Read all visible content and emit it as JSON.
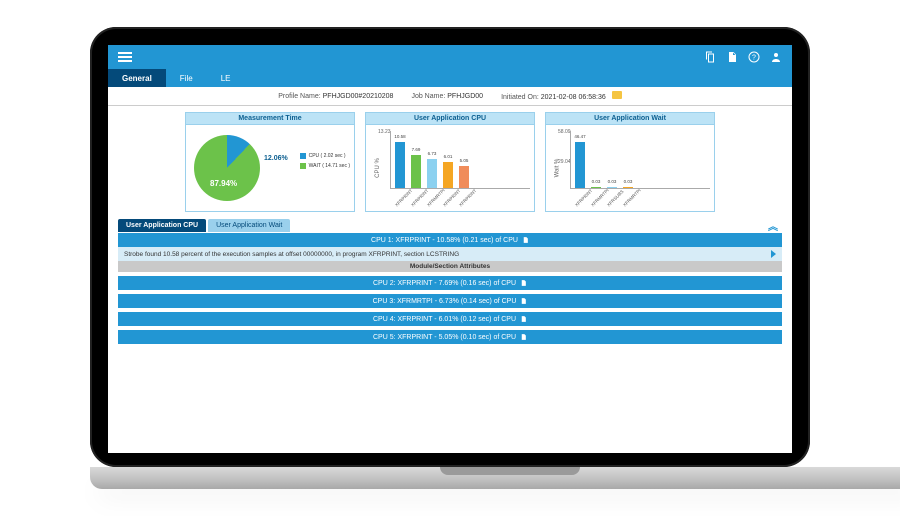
{
  "tabs": {
    "general": "General",
    "file": "File",
    "le": "LE"
  },
  "meta": {
    "profile_lbl": "Profile Name:",
    "profile_val": "PFHJGD00#20210208",
    "job_lbl": "Job Name:",
    "job_val": "PFHJGD00",
    "init_lbl": "Initiated On:",
    "init_val": "2021-02-08 06:58:36"
  },
  "cards": {
    "measurement_title": "Measurement Time",
    "app_cpu_title": "User Application CPU",
    "app_wait_title": "User Application Wait",
    "pie_pct_cpu": "12.06%",
    "pie_pct_wait": "87.94%",
    "legend_cpu": "CPU ( 2.02 sec )",
    "legend_wait": "WAIT ( 14.71 sec )",
    "cpu_ylabel": "CPU %",
    "wait_ylabel": "Wait %",
    "cpu_ytick_top": "13.23",
    "wait_ytick_top": "58.09",
    "wait_ytick_mid": "29.04"
  },
  "result_tabs": {
    "cpu": "User Application CPU",
    "wait": "User Application Wait"
  },
  "rows": {
    "r1": "CPU 1: XFRPRINT - 10.58% (0.21 sec) of CPU",
    "r1_detail": "Strobe found 10.58 percent of the execution samples at offset 00000000, in program XFRPRINT, section LCSTRING",
    "r1_attr": "Module/Section Attributes",
    "r2": "CPU 2: XFRPRINT - 7.69% (0.16 sec) of CPU",
    "r3": "CPU 3: XFRMRTPI - 6.73% (0.14 sec) of CPU",
    "r4": "CPU 4: XFRPRINT - 6.01% (0.12 sec) of CPU",
    "r5": "CPU 5: XFRPRINT - 5.05% (0.10 sec) of CPU"
  },
  "chart_data": [
    {
      "type": "pie",
      "title": "Measurement Time",
      "series": [
        {
          "name": "CPU",
          "value": 12.06,
          "seconds": 2.02,
          "color": "#2296d3"
        },
        {
          "name": "WAIT",
          "value": 87.94,
          "seconds": 14.71,
          "color": "#6cc24a"
        }
      ]
    },
    {
      "type": "bar",
      "title": "User Application CPU",
      "ylabel": "CPU %",
      "ylim": [
        0,
        13.23
      ],
      "categories": [
        "XFRPRINT",
        "XFRPRINT",
        "XFRMRTPI",
        "XFRPRINT",
        "XFRPRINT"
      ],
      "values": [
        10.58,
        7.69,
        6.73,
        6.01,
        5.05
      ],
      "colors": [
        "#2296d3",
        "#6cc24a",
        "#8bd1f0",
        "#f5a623",
        "#f08c5a"
      ]
    },
    {
      "type": "bar",
      "title": "User Application Wait",
      "ylabel": "Wait %",
      "ylim": [
        0,
        58.09
      ],
      "categories": [
        "XFRPRINT",
        "XFRMRTPI",
        "XFRSUBS",
        "XFRMRTPI"
      ],
      "values": [
        46.47,
        0.03,
        0.03,
        0.03
      ],
      "colors": [
        "#2296d3",
        "#6cc24a",
        "#8bd1f0",
        "#f5a623"
      ]
    }
  ]
}
